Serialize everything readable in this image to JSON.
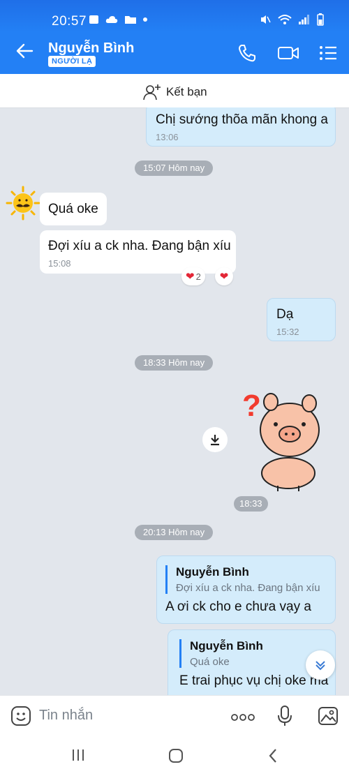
{
  "status": {
    "time": "20:57"
  },
  "header": {
    "title": "Nguyễn Bình",
    "badge": "NGƯỜI LẠ"
  },
  "friend_bar": {
    "label": "Kết bạn"
  },
  "messages": {
    "m1": {
      "text": "Chị sướng thõa mãn khong a",
      "time": "13:06"
    },
    "sep1": "15:07 Hôm nay",
    "m2": {
      "text": "Quá oke"
    },
    "m3": {
      "text": "Đợi xíu a ck nha. Đang bận xíu",
      "time": "15:08",
      "reaction_count": "2"
    },
    "m4": {
      "text": "Dạ",
      "time": "15:32"
    },
    "sep2": "18:33 Hôm nay",
    "sticker_time": "18:33",
    "sep3": "20:13 Hôm nay",
    "m5": {
      "quote_name": "Nguyễn Bình",
      "quote_text": "Đợi xíu a ck nha. Đang bận xíu",
      "text": "A ơi ck cho e chưa vạy a"
    },
    "m6": {
      "quote_name": "Nguyễn Bình",
      "quote_text": "Quá oke",
      "text": "E trai phục vụ chị oke ma"
    }
  },
  "composer": {
    "placeholder": "Tin nhắn"
  },
  "colors": {
    "accent": "#2380f5",
    "outgoing_bubble": "#d4ecfb",
    "chat_bg": "#e2e6ec"
  },
  "icons": [
    "back-arrow-icon",
    "phone-icon",
    "video-icon",
    "list-menu-icon",
    "add-friend-icon",
    "download-icon",
    "heart-icon",
    "scroll-down-icon",
    "sticker-icon",
    "more-icon",
    "mic-icon",
    "image-icon",
    "recent-apps-icon",
    "home-icon",
    "back-nav-icon"
  ]
}
